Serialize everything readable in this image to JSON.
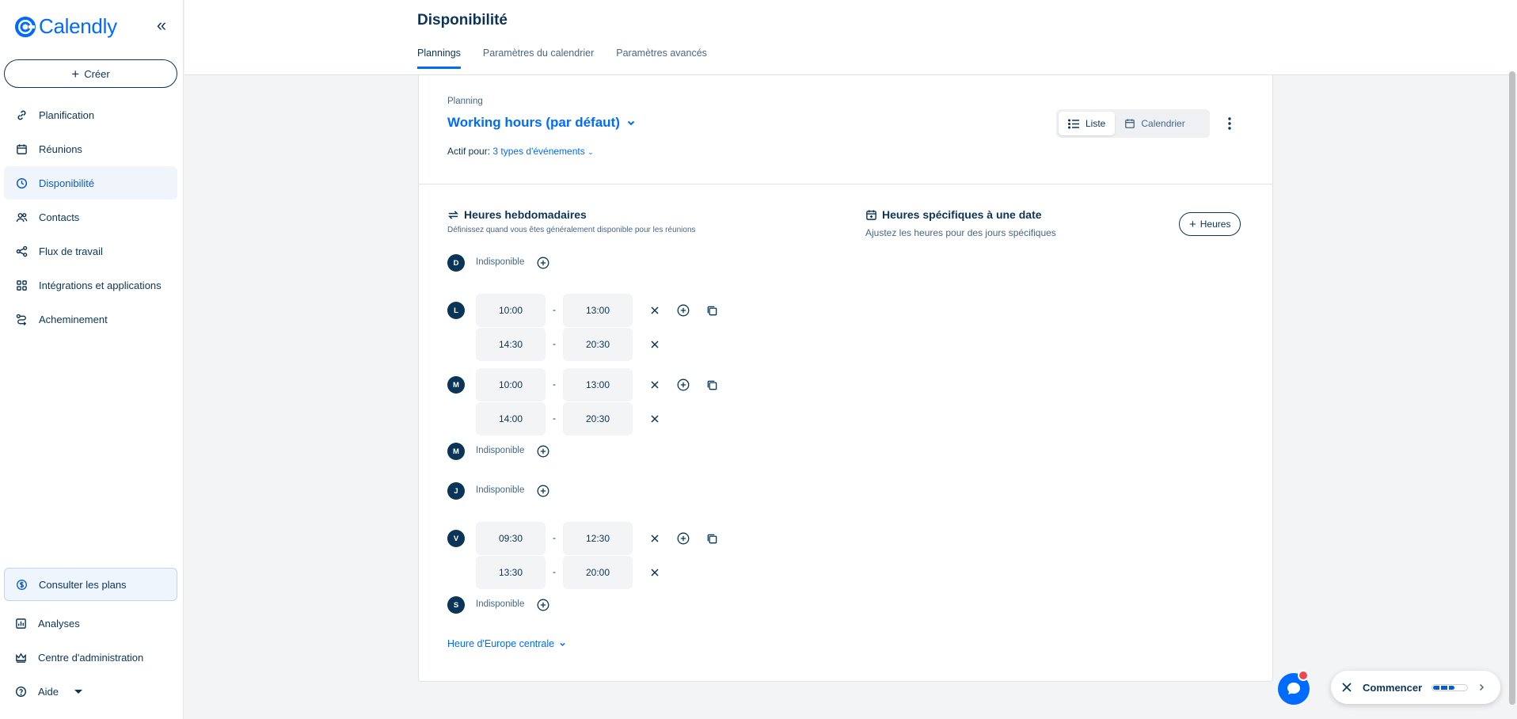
{
  "brand": {
    "name": "Calendly",
    "color": "#006bff"
  },
  "sidebar": {
    "create_label": "Créer",
    "items": [
      {
        "label": "Planification",
        "icon": "link-icon"
      },
      {
        "label": "Réunions",
        "icon": "calendar-icon"
      },
      {
        "label": "Disponibilité",
        "icon": "clock-icon",
        "active": true
      },
      {
        "label": "Contacts",
        "icon": "contacts-icon"
      },
      {
        "label": "Flux de travail",
        "icon": "workflow-icon"
      },
      {
        "label": "Intégrations et applications",
        "icon": "apps-grid-icon"
      },
      {
        "label": "Acheminement",
        "icon": "routing-icon"
      }
    ],
    "plans_label": "Consulter les plans",
    "bottom_items": [
      {
        "label": "Analyses",
        "icon": "bar-chart-icon"
      },
      {
        "label": "Centre d'administration",
        "icon": "crown-icon"
      },
      {
        "label": "Aide",
        "icon": "help-icon"
      }
    ]
  },
  "header": {
    "title": "Disponibilité",
    "tabs": [
      {
        "label": "Plannings",
        "active": true
      },
      {
        "label": "Paramètres du calendrier"
      },
      {
        "label": "Paramètres avancés"
      }
    ]
  },
  "schedule": {
    "section_label": "Planning",
    "name": "Working hours (par défaut)",
    "active_for_label": "Actif pour:",
    "active_for_link": "3 types d'événements",
    "view_list": "Liste",
    "view_calendar": "Calendrier"
  },
  "weekly": {
    "title": "Heures hebdomadaires",
    "subtitle": "Définissez quand vous êtes généralement disponible pour les réunions",
    "unavailable_label": "Indisponible",
    "days": [
      {
        "letter": "D",
        "slots": []
      },
      {
        "letter": "L",
        "slots": [
          [
            "10:00",
            "13:00"
          ],
          [
            "14:30",
            "20:30"
          ]
        ]
      },
      {
        "letter": "M",
        "slots": [
          [
            "10:00",
            "13:00"
          ],
          [
            "14:00",
            "20:30"
          ]
        ]
      },
      {
        "letter": "M",
        "slots": []
      },
      {
        "letter": "J",
        "slots": []
      },
      {
        "letter": "V",
        "slots": [
          [
            "09:30",
            "12:30"
          ],
          [
            "13:30",
            "20:00"
          ]
        ]
      },
      {
        "letter": "S",
        "slots": []
      }
    ],
    "timezone": "Heure d'Europe centrale"
  },
  "specific": {
    "title": "Heures spécifiques à une date",
    "subtitle": "Ajustez les heures pour des jours spécifiques",
    "button_label": "Heures"
  },
  "onboarding": {
    "label": "Commencer",
    "progress": 0.6
  }
}
